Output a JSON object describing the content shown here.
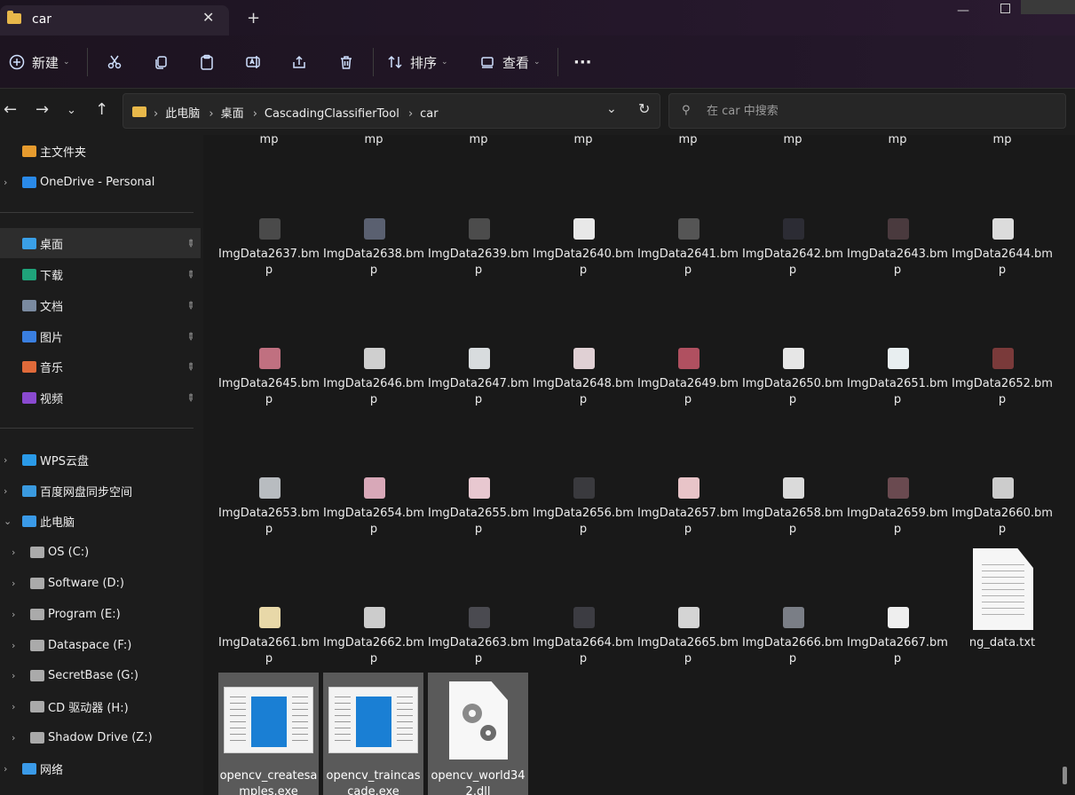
{
  "window": {
    "tab_title": "car",
    "new_tab": "+",
    "close_tab": "✕",
    "minimize": "—"
  },
  "toolbar": {
    "new_label": "新建",
    "sort_label": "排序",
    "view_label": "查看",
    "more": "···"
  },
  "address": {
    "crumbs": [
      "此电脑",
      "桌面",
      "CascadingClassifierTool",
      "car"
    ],
    "chevron": "›"
  },
  "search": {
    "placeholder": "在 car 中搜索"
  },
  "sidebar": {
    "items": [
      {
        "label": "主文件夹",
        "color": "#e69b2e"
      },
      {
        "label": "OneDrive - Personal",
        "color": "#2a8ae8"
      },
      {
        "label": "桌面",
        "color": "#3aa0e8",
        "pinned": true
      },
      {
        "label": "下载",
        "color": "#1fa37a",
        "pinned": true
      },
      {
        "label": "文档",
        "color": "#7a8aa0",
        "pinned": true
      },
      {
        "label": "图片",
        "color": "#3a7fe0",
        "pinned": true
      },
      {
        "label": "音乐",
        "color": "#e06a3a",
        "pinned": true
      },
      {
        "label": "视频",
        "color": "#8a4ad0",
        "pinned": true
      },
      {
        "label": "WPS云盘",
        "color": "#2a9ae8"
      },
      {
        "label": "百度网盘同步空间",
        "color": "#3a9ae0"
      },
      {
        "label": "此电脑",
        "color": "#3a9ae8"
      },
      {
        "label": "OS (C:)",
        "color": "#aaaaaa"
      },
      {
        "label": "Software (D:)",
        "color": "#aaaaaa"
      },
      {
        "label": "Program (E:)",
        "color": "#aaaaaa"
      },
      {
        "label": "Dataspace (F:)",
        "color": "#aaaaaa"
      },
      {
        "label": "SecretBase (G:)",
        "color": "#aaaaaa"
      },
      {
        "label": "CD 驱动器 (H:)",
        "color": "#aaaaaa"
      },
      {
        "label": "Shadow Drive (Z:)",
        "color": "#aaaaaa"
      },
      {
        "label": "网络",
        "color": "#3a9ae8"
      }
    ],
    "pin_glyph": "📌"
  },
  "files": {
    "top_row": [
      "mp",
      "mp",
      "mp",
      "mp",
      "mp",
      "mp",
      "mp",
      "mp"
    ],
    "rows": [
      [
        "ImgData2637.bmp",
        "ImgData2638.bmp",
        "ImgData2639.bmp",
        "ImgData2640.bmp",
        "ImgData2641.bmp",
        "ImgData2642.bmp",
        "ImgData2643.bmp",
        "ImgData2644.bmp"
      ],
      [
        "ImgData2645.bmp",
        "ImgData2646.bmp",
        "ImgData2647.bmp",
        "ImgData2648.bmp",
        "ImgData2649.bmp",
        "ImgData2650.bmp",
        "ImgData2651.bmp",
        "ImgData2652.bmp"
      ],
      [
        "ImgData2653.bmp",
        "ImgData2654.bmp",
        "ImgData2655.bmp",
        "ImgData2656.bmp",
        "ImgData2657.bmp",
        "ImgData2658.bmp",
        "ImgData2659.bmp",
        "ImgData2660.bmp"
      ],
      [
        "ImgData2661.bmp",
        "ImgData2662.bmp",
        "ImgData2663.bmp",
        "ImgData2664.bmp",
        "ImgData2665.bmp",
        "ImgData2666.bmp",
        "ImgData2667.bmp"
      ]
    ],
    "thumb_colors": [
      [
        "#4a4a4a",
        "#5a6070",
        "#4c4c4c",
        "#e8e8e8",
        "#555555",
        "#2c2c34",
        "#4a3a3e",
        "#dcdcdc"
      ],
      [
        "#c07080",
        "#cfcfcf",
        "#d8dcde",
        "#e0d0d4",
        "#b05060",
        "#e6e6e6",
        "#e8eef0",
        "#7a3a3a"
      ],
      [
        "#b8bcc0",
        "#d8a8b8",
        "#e8c8d0",
        "#3a3a3e",
        "#e8c4c8",
        "#dadada",
        "#6a4a50",
        "#cccccc"
      ],
      [
        "#e8d8a8",
        "#cccccc",
        "#4a4a50",
        "#3c3c42",
        "#d4d4d4",
        "#7a7e86",
        "#eeeeee"
      ]
    ],
    "txt_file": "ng_data.txt",
    "exe_files": [
      "opencv_createsamples.exe",
      "opencv_traincascade.exe",
      "opencv_world342.dll"
    ]
  }
}
